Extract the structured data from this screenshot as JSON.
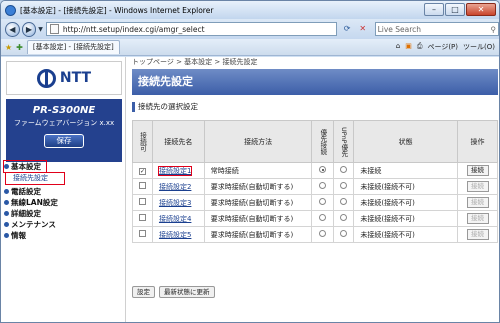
{
  "window": {
    "title": "[基本設定] - [接続先設定] - Windows Internet Explorer",
    "btn_min": "–",
    "btn_max": "□",
    "btn_close": "✕"
  },
  "address": {
    "url": "http://ntt.setup/index.cgi/amgr_select",
    "search_placeholder": "Live Search"
  },
  "tab": {
    "label": "[基本設定] - [接続先設定]"
  },
  "tools": {
    "page": "ページ(P)",
    "tool": "ツール(O)"
  },
  "sidebar": {
    "brand": "NTT",
    "model": "PR-S300NE",
    "version": "ファームウェアバージョン x.xx",
    "save": "保存",
    "menu": [
      "基本設定",
      "電話設定",
      "無線LAN設定",
      "詳細設定",
      "メンテナンス",
      "情報"
    ],
    "submenu": "接続先設定"
  },
  "main": {
    "breadcrumb": "トップページ > 基本設定 > 接続先設定",
    "page_title": "接続先設定",
    "section": "接続先の選択設定",
    "headers": [
      "接続可",
      "接続先名",
      "接続方法",
      "優先接続",
      "UPnP優先",
      "状態",
      "操作"
    ],
    "rows": [
      {
        "name": "接続設定1",
        "method": "常時接続",
        "status": "未接続",
        "op": "接続",
        "checked": true,
        "prio": true,
        "upnp": false
      },
      {
        "name": "接続設定2",
        "method": "要求時接続(自動切断する)",
        "status": "未接続(接続不可)",
        "op": "接続",
        "checked": false,
        "prio": false,
        "upnp": false
      },
      {
        "name": "接続設定3",
        "method": "要求時接続(自動切断する)",
        "status": "未接続(接続不可)",
        "op": "接続",
        "checked": false,
        "prio": false,
        "upnp": false
      },
      {
        "name": "接続設定4",
        "method": "要求時接続(自動切断する)",
        "status": "未接続(接続不可)",
        "op": "接続",
        "checked": false,
        "prio": false,
        "upnp": false
      },
      {
        "name": "接続設定5",
        "method": "要求時接続(自動切断する)",
        "status": "未接続(接続不可)",
        "op": "接続",
        "checked": false,
        "prio": false,
        "upnp": false
      }
    ],
    "btn_set": "設定",
    "btn_refresh": "最新状態に更新"
  }
}
